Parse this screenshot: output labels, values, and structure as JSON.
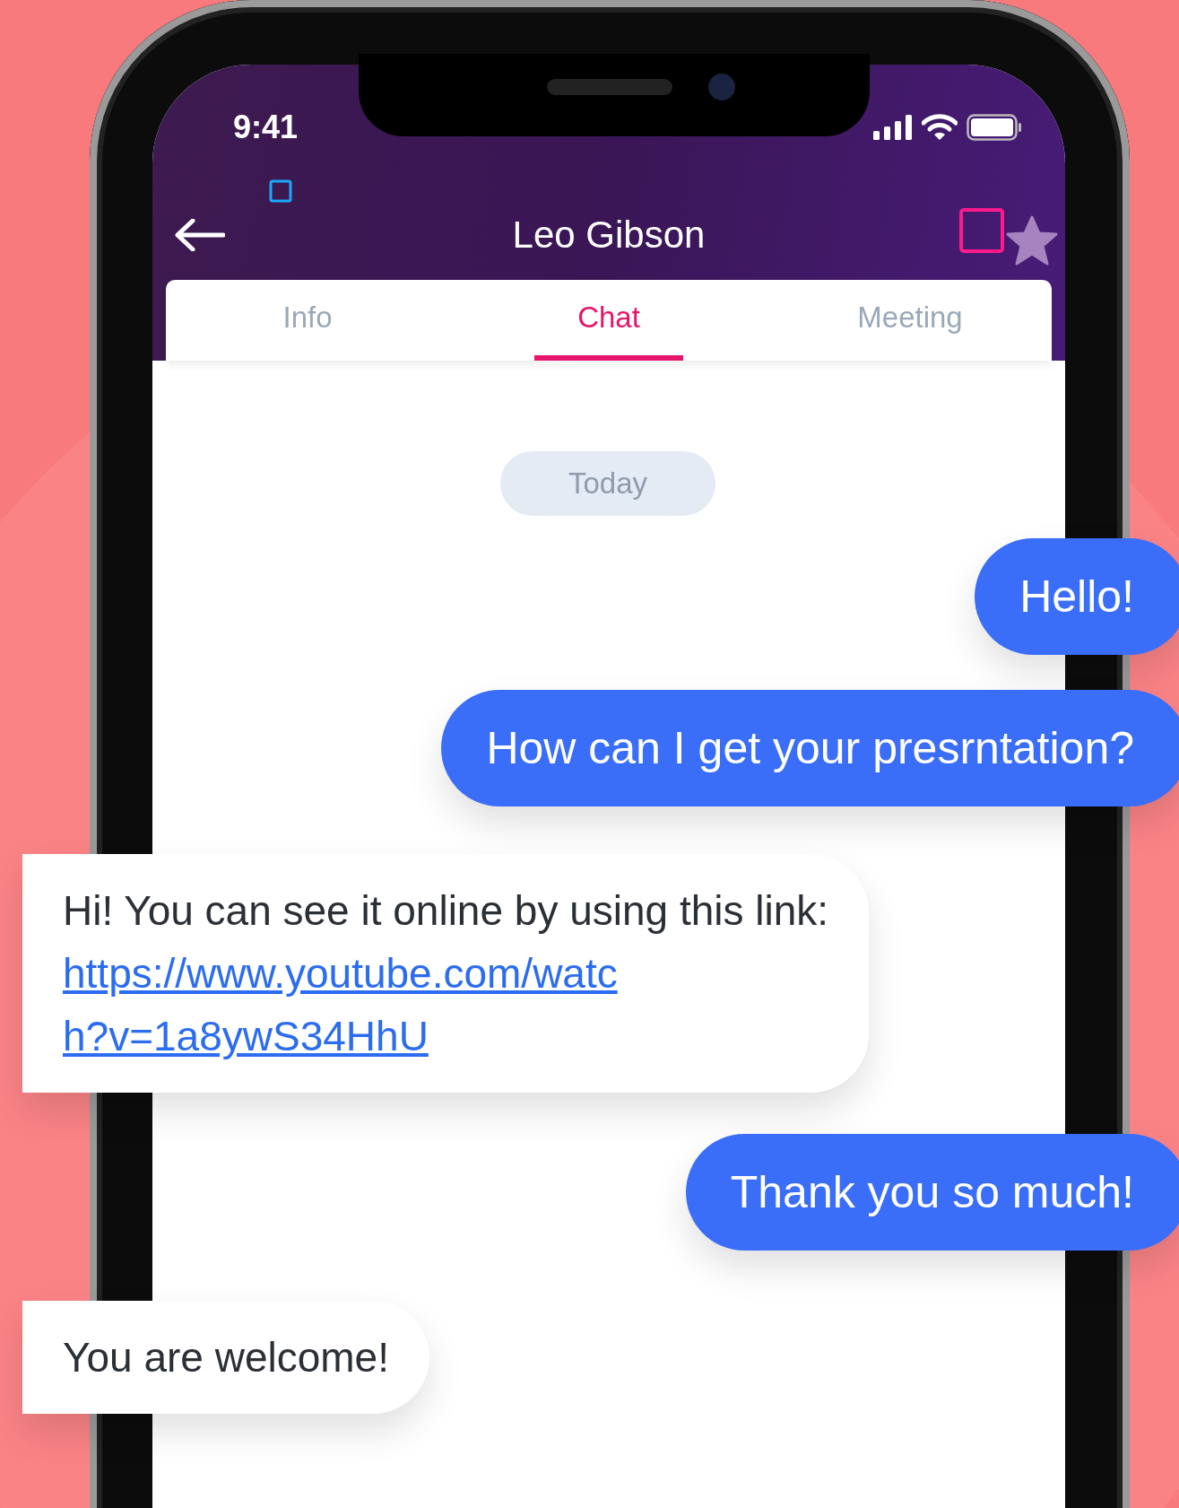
{
  "status_bar": {
    "time": "9:41"
  },
  "header": {
    "title": "Leo Gibson"
  },
  "tabs": [
    {
      "label": "Info",
      "selected": false
    },
    {
      "label": "Chat",
      "selected": true
    },
    {
      "label": "Meeting",
      "selected": false
    }
  ],
  "date_divider": "Today",
  "messages": [
    {
      "kind": "sent",
      "text": "Hello!"
    },
    {
      "kind": "sent",
      "text": "How can I get your presrntation?"
    },
    {
      "kind": "received",
      "text": "Hi! You can see it online by using this link:",
      "link": "https://www.youtube.com/watch?v=1a8ywS34HhU"
    },
    {
      "kind": "sent",
      "text": "Thank you so much!"
    },
    {
      "kind": "received",
      "text": "You are welcome!"
    }
  ]
}
